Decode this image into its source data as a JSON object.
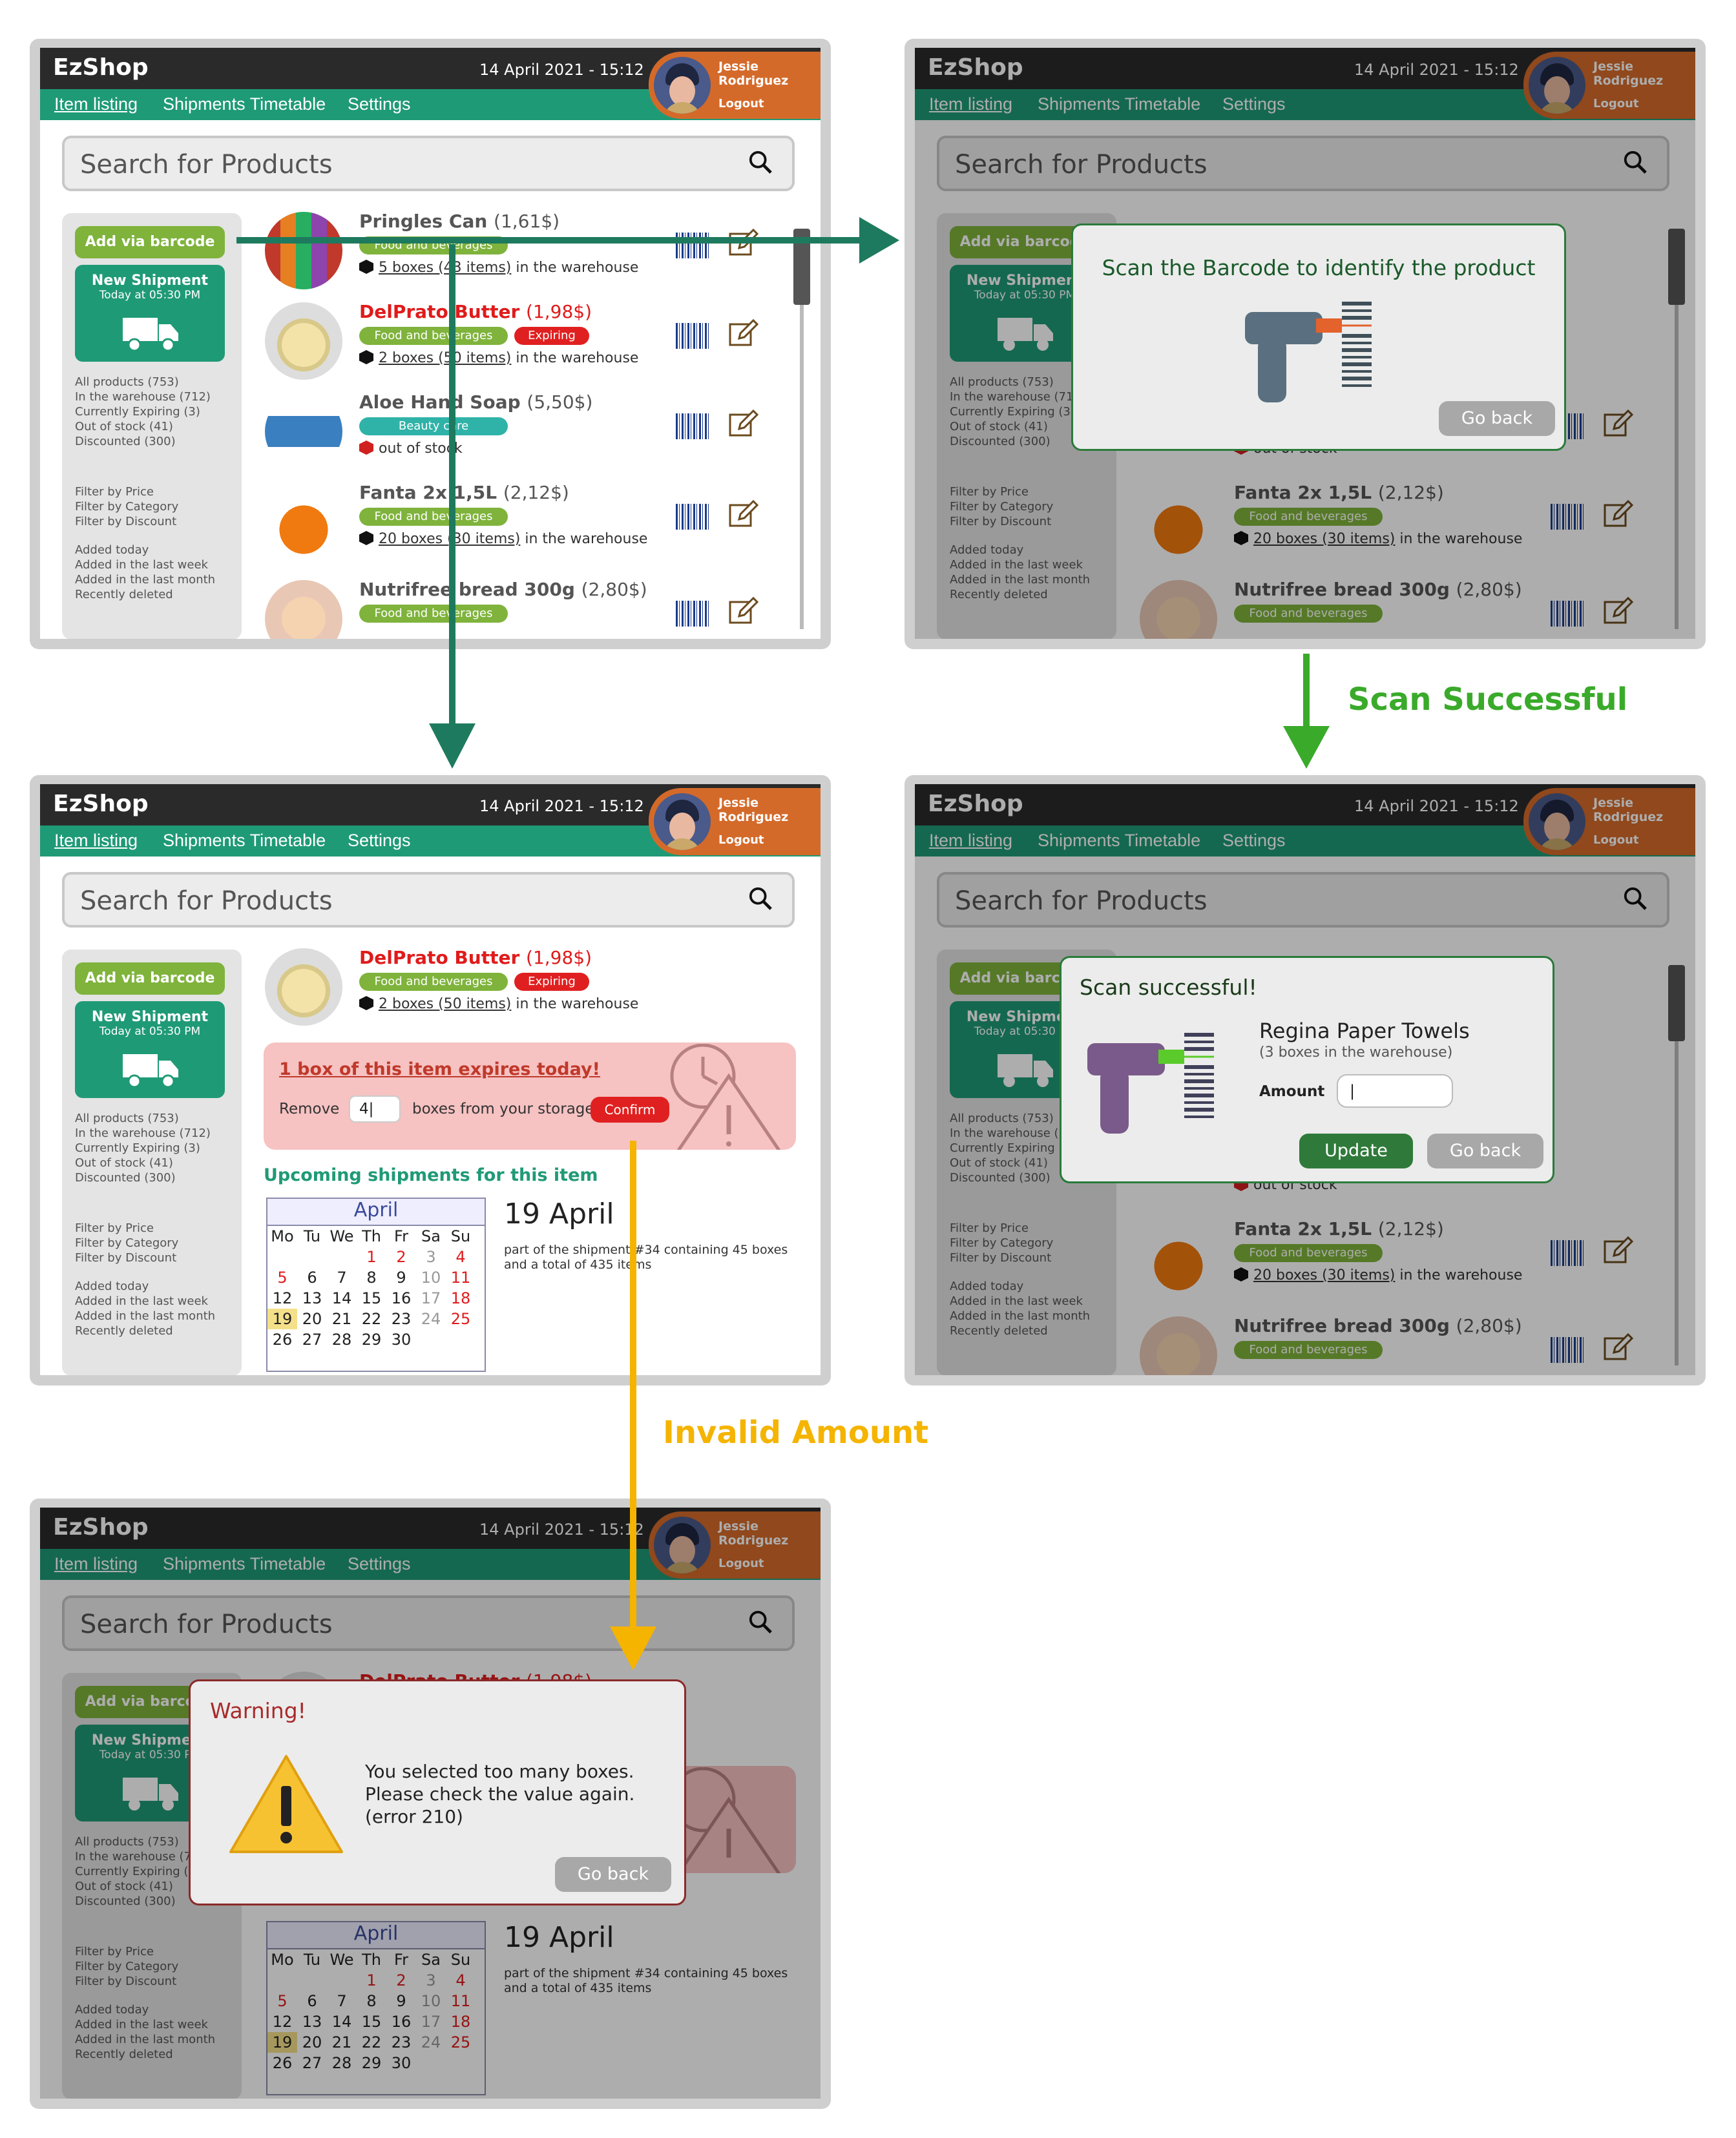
{
  "app": {
    "logo": "EzShop",
    "datetime": "14 April 2021 - 15:12",
    "user_first": "Jessie",
    "user_last": "Rodriguez",
    "logout": "Logout",
    "nav": [
      "Item listing",
      "Shipments Timetable",
      "Settings"
    ],
    "search_placeholder": "Search for Products",
    "add_barcode": "Add via barcode",
    "new_shipment": "New Shipment",
    "shipment_time": "Today at 05:30 PM",
    "stats": [
      "All products (753)",
      "In the warehouse (712)",
      "Currently Expiring (3)",
      "Out of stock (41)",
      "Discounted (300)"
    ],
    "filters": [
      "Filter by Price",
      "Filter by Category",
      "Filter by Discount"
    ],
    "recent": [
      "Added today",
      "Added in the last week",
      "Added in the last month",
      "Recently deleted"
    ]
  },
  "products": [
    {
      "name": "Pringles Can",
      "price": "(1,61$)",
      "tag": "Food and beverages",
      "stock_link": "5 boxes (43 items)",
      "stock_rest": " in the warehouse"
    },
    {
      "name": "DelPrato Butter",
      "price": "(1,98$)",
      "tag": "Food and beverages",
      "tag2": "Expiring",
      "stock_link": "2 boxes (50 items)",
      "stock_rest": " in the warehouse"
    },
    {
      "name": "Aloe Hand Soap",
      "price": "(5,50$)",
      "tag": "Beauty care",
      "stock_out": "out of stock"
    },
    {
      "name": "Fanta 2x 1,5L",
      "price": "(2,12$)",
      "tag": "Food and beverages",
      "stock_link": "20 boxes (30 items)",
      "stock_rest": " in the warehouse"
    },
    {
      "name": "Nutrifree bread 300g",
      "price": "(2,80$)",
      "tag": "Food and beverages"
    }
  ],
  "scan_modal": {
    "title": "Scan the Barcode to identify the product",
    "back": "Go back"
  },
  "success_modal": {
    "title": "Scan successful!",
    "product": "Regina Paper Towels",
    "sub": "(3 boxes in the warehouse)",
    "amount_label": "Amount",
    "amount_value": "|",
    "update": "Update",
    "back": "Go back"
  },
  "detail": {
    "alert_title": "1 box of this item expires today!",
    "remove_label": "Remove",
    "remove_value": "4|",
    "remove_suffix": "boxes from your storage",
    "confirm": "Confirm",
    "upcoming": "Upcoming shipments for this item",
    "cal_month": "April",
    "cal_days": [
      "Mo",
      "Tu",
      "We",
      "Th",
      "Fr",
      "Sa",
      "Su"
    ],
    "cal_weeks": [
      [
        "",
        "",
        "",
        "1",
        "2",
        "3",
        "4"
      ],
      [
        "5",
        "6",
        "7",
        "8",
        "9",
        "10",
        "11"
      ],
      [
        "12",
        "13",
        "14",
        "15",
        "16",
        "17",
        "18"
      ],
      [
        "19",
        "20",
        "21",
        "22",
        "23",
        "24",
        "25"
      ],
      [
        "26",
        "27",
        "28",
        "29",
        "30",
        "",
        ""
      ]
    ],
    "ship_date": "19 April",
    "ship_desc1": "part of the shipment #34 containing 45 boxes",
    "ship_desc2": "and a total of 435 items"
  },
  "warning_modal": {
    "title": "Warning!",
    "line1": "You selected too many boxes.",
    "line2": "Please check the value again.",
    "line3": "(error 210)",
    "back": "Go back"
  },
  "flow_labels": {
    "scan_ok": "Scan Successful",
    "invalid": "Invalid Amount"
  },
  "colors": {
    "green": "#1f9a76",
    "olive": "#7fb33c",
    "orange": "#d46a2a",
    "flow_dark": "#1e7a5e",
    "flow_green": "#3aaa2a",
    "flow_yellow": "#f4b400"
  }
}
